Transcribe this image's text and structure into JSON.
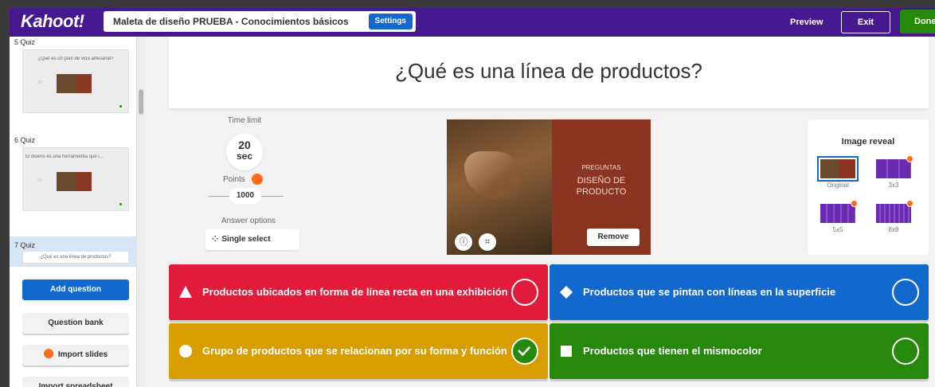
{
  "topbar": {
    "logo": "Kahoot!",
    "title": "Maleta de diseño PRUEBA - Conocimientos básicos",
    "settings_label": "Settings",
    "preview_label": "Preview",
    "exit_label": "Exit",
    "done_label": "Done"
  },
  "sidebar": {
    "slides": [
      {
        "num": "5 Quiz",
        "text": "¿Qué es un plan de vida artesanal?",
        "thumb_label": "20"
      },
      {
        "num": "6 Quiz",
        "text": "El diseño es una herramienta que i...",
        "thumb_label": "20"
      },
      {
        "num": "7 Quiz",
        "text": "¿Qué es una línea de productos?"
      }
    ],
    "add_question": "Add question",
    "question_bank": "Question bank",
    "import_slides": "Import slides",
    "import_spreadsheet": "Import spreadsheet"
  },
  "question": {
    "text": "¿Qué es una línea de productos?"
  },
  "options": {
    "time_limit_label": "Time limit",
    "time_value": "20",
    "time_unit": "sec",
    "points_label": "Points",
    "points_value": "1000",
    "answer_options_label": "Answer options",
    "answer_type": "Single select"
  },
  "media": {
    "caption_small": "PREGUNTAS",
    "caption_large": "DISEÑO DE PRODUCTO",
    "remove_label": "Remove"
  },
  "image_reveal": {
    "title": "Image reveal",
    "options": [
      {
        "label": "Original",
        "selected": true
      },
      {
        "label": "3x3"
      },
      {
        "label": "5x5"
      },
      {
        "label": "8x8"
      }
    ]
  },
  "answers": [
    {
      "text": "Productos ubicados en forma de línea recta en una exhibición",
      "shape": "triangle",
      "color": "#e21b3c",
      "correct": false
    },
    {
      "text": "Productos que se pintan con líneas en la superficie",
      "shape": "diamond",
      "color": "#1368ce",
      "correct": false
    },
    {
      "text": "Grupo de productos que se relacionan por su forma y función",
      "shape": "circle",
      "color": "#d89e00",
      "correct": true
    },
    {
      "text": "Productos que tienen el  mismocolor",
      "shape": "square",
      "color": "#26890c",
      "correct": false
    }
  ]
}
